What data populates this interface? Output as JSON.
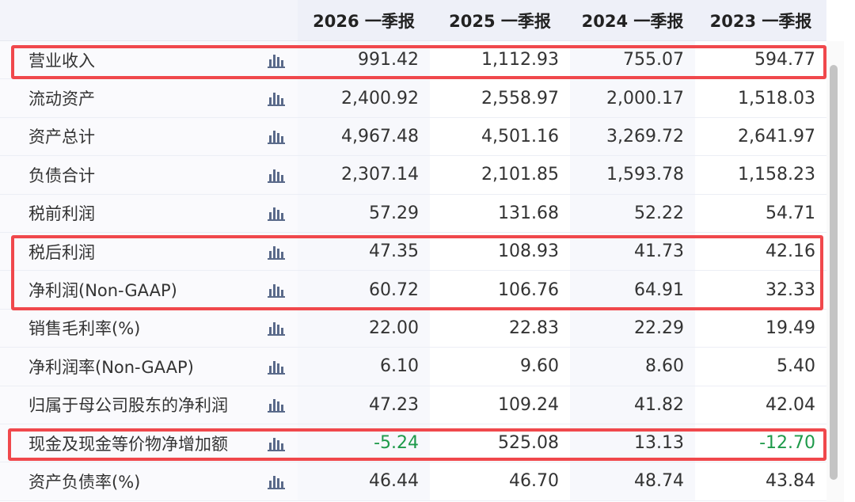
{
  "header": {
    "columns": [
      "2026 一季报",
      "2025 一季报",
      "2024 一季报",
      "2023 一季报"
    ]
  },
  "rows": [
    {
      "label": "营业收入",
      "values": [
        "991.42",
        "1,112.93",
        "755.07",
        "594.77"
      ]
    },
    {
      "label": "流动资产",
      "values": [
        "2,400.92",
        "2,558.97",
        "2,000.17",
        "1,518.03"
      ]
    },
    {
      "label": "资产总计",
      "values": [
        "4,967.48",
        "4,501.16",
        "3,269.72",
        "2,641.97"
      ]
    },
    {
      "label": "负债合计",
      "values": [
        "2,307.14",
        "2,101.85",
        "1,593.78",
        "1,158.23"
      ]
    },
    {
      "label": "税前利润",
      "values": [
        "57.29",
        "131.68",
        "52.22",
        "54.71"
      ]
    },
    {
      "label": "税后利润",
      "values": [
        "47.35",
        "108.93",
        "41.73",
        "42.16"
      ]
    },
    {
      "label": "净利润(Non-GAAP)",
      "values": [
        "60.72",
        "106.76",
        "64.91",
        "32.33"
      ]
    },
    {
      "label": "销售毛利率(%)",
      "values": [
        "22.00",
        "22.83",
        "22.29",
        "19.49"
      ]
    },
    {
      "label": "净利润率(Non-GAAP)",
      "values": [
        "6.10",
        "9.60",
        "8.60",
        "5.40"
      ]
    },
    {
      "label": "归属于母公司股东的净利润",
      "values": [
        "47.23",
        "109.24",
        "41.82",
        "42.04"
      ]
    },
    {
      "label": "现金及现金等价物净增加额",
      "values": [
        "-5.24",
        "525.08",
        "13.13",
        "-12.70"
      ]
    },
    {
      "label": "资产负债率(%)",
      "values": [
        "46.44",
        "46.70",
        "48.74",
        "43.84"
      ]
    }
  ],
  "colors": {
    "highlight": "#f0484c",
    "negative": "#1e9a4a",
    "icon": "#5a6a8a"
  },
  "icons": {
    "row_chart": "bar-chart-icon"
  }
}
